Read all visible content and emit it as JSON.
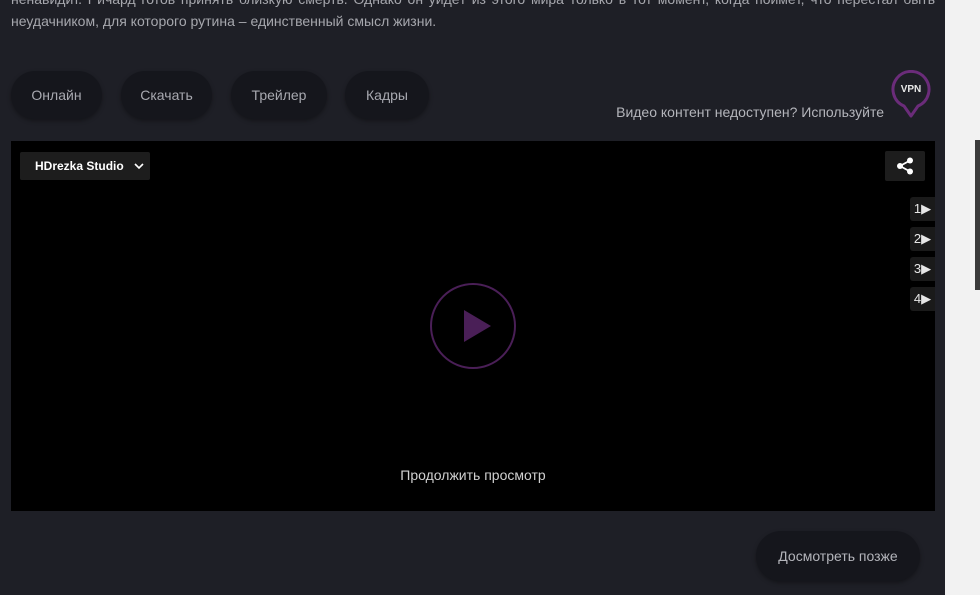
{
  "description": {
    "line1": "ненавидит. Ричард готов принять близкую смерть. Однако он уйдёт из этого мира только в тот момент, когда поймёт, что перестал быть",
    "line2": "неудачником, для которого рутина – единственный смысл жизни."
  },
  "tabs": [
    {
      "label": "Онлайн"
    },
    {
      "label": "Скачать"
    },
    {
      "label": "Трейлер"
    },
    {
      "label": "Кадры"
    }
  ],
  "vpn": {
    "hint": "Видео контент недоступен? Используйте",
    "badge": "VPN",
    "accent": "#6b2c7a"
  },
  "player": {
    "translator": "HDrezka Studio",
    "continue_label": "Продолжить просмотр",
    "play_color": "#4a1f57",
    "quality_items": [
      {
        "label": "1▶"
      },
      {
        "label": "2▶"
      },
      {
        "label": "3▶"
      },
      {
        "label": "4▶"
      }
    ]
  },
  "actions": {
    "watch_later": "Досмотреть позже"
  }
}
